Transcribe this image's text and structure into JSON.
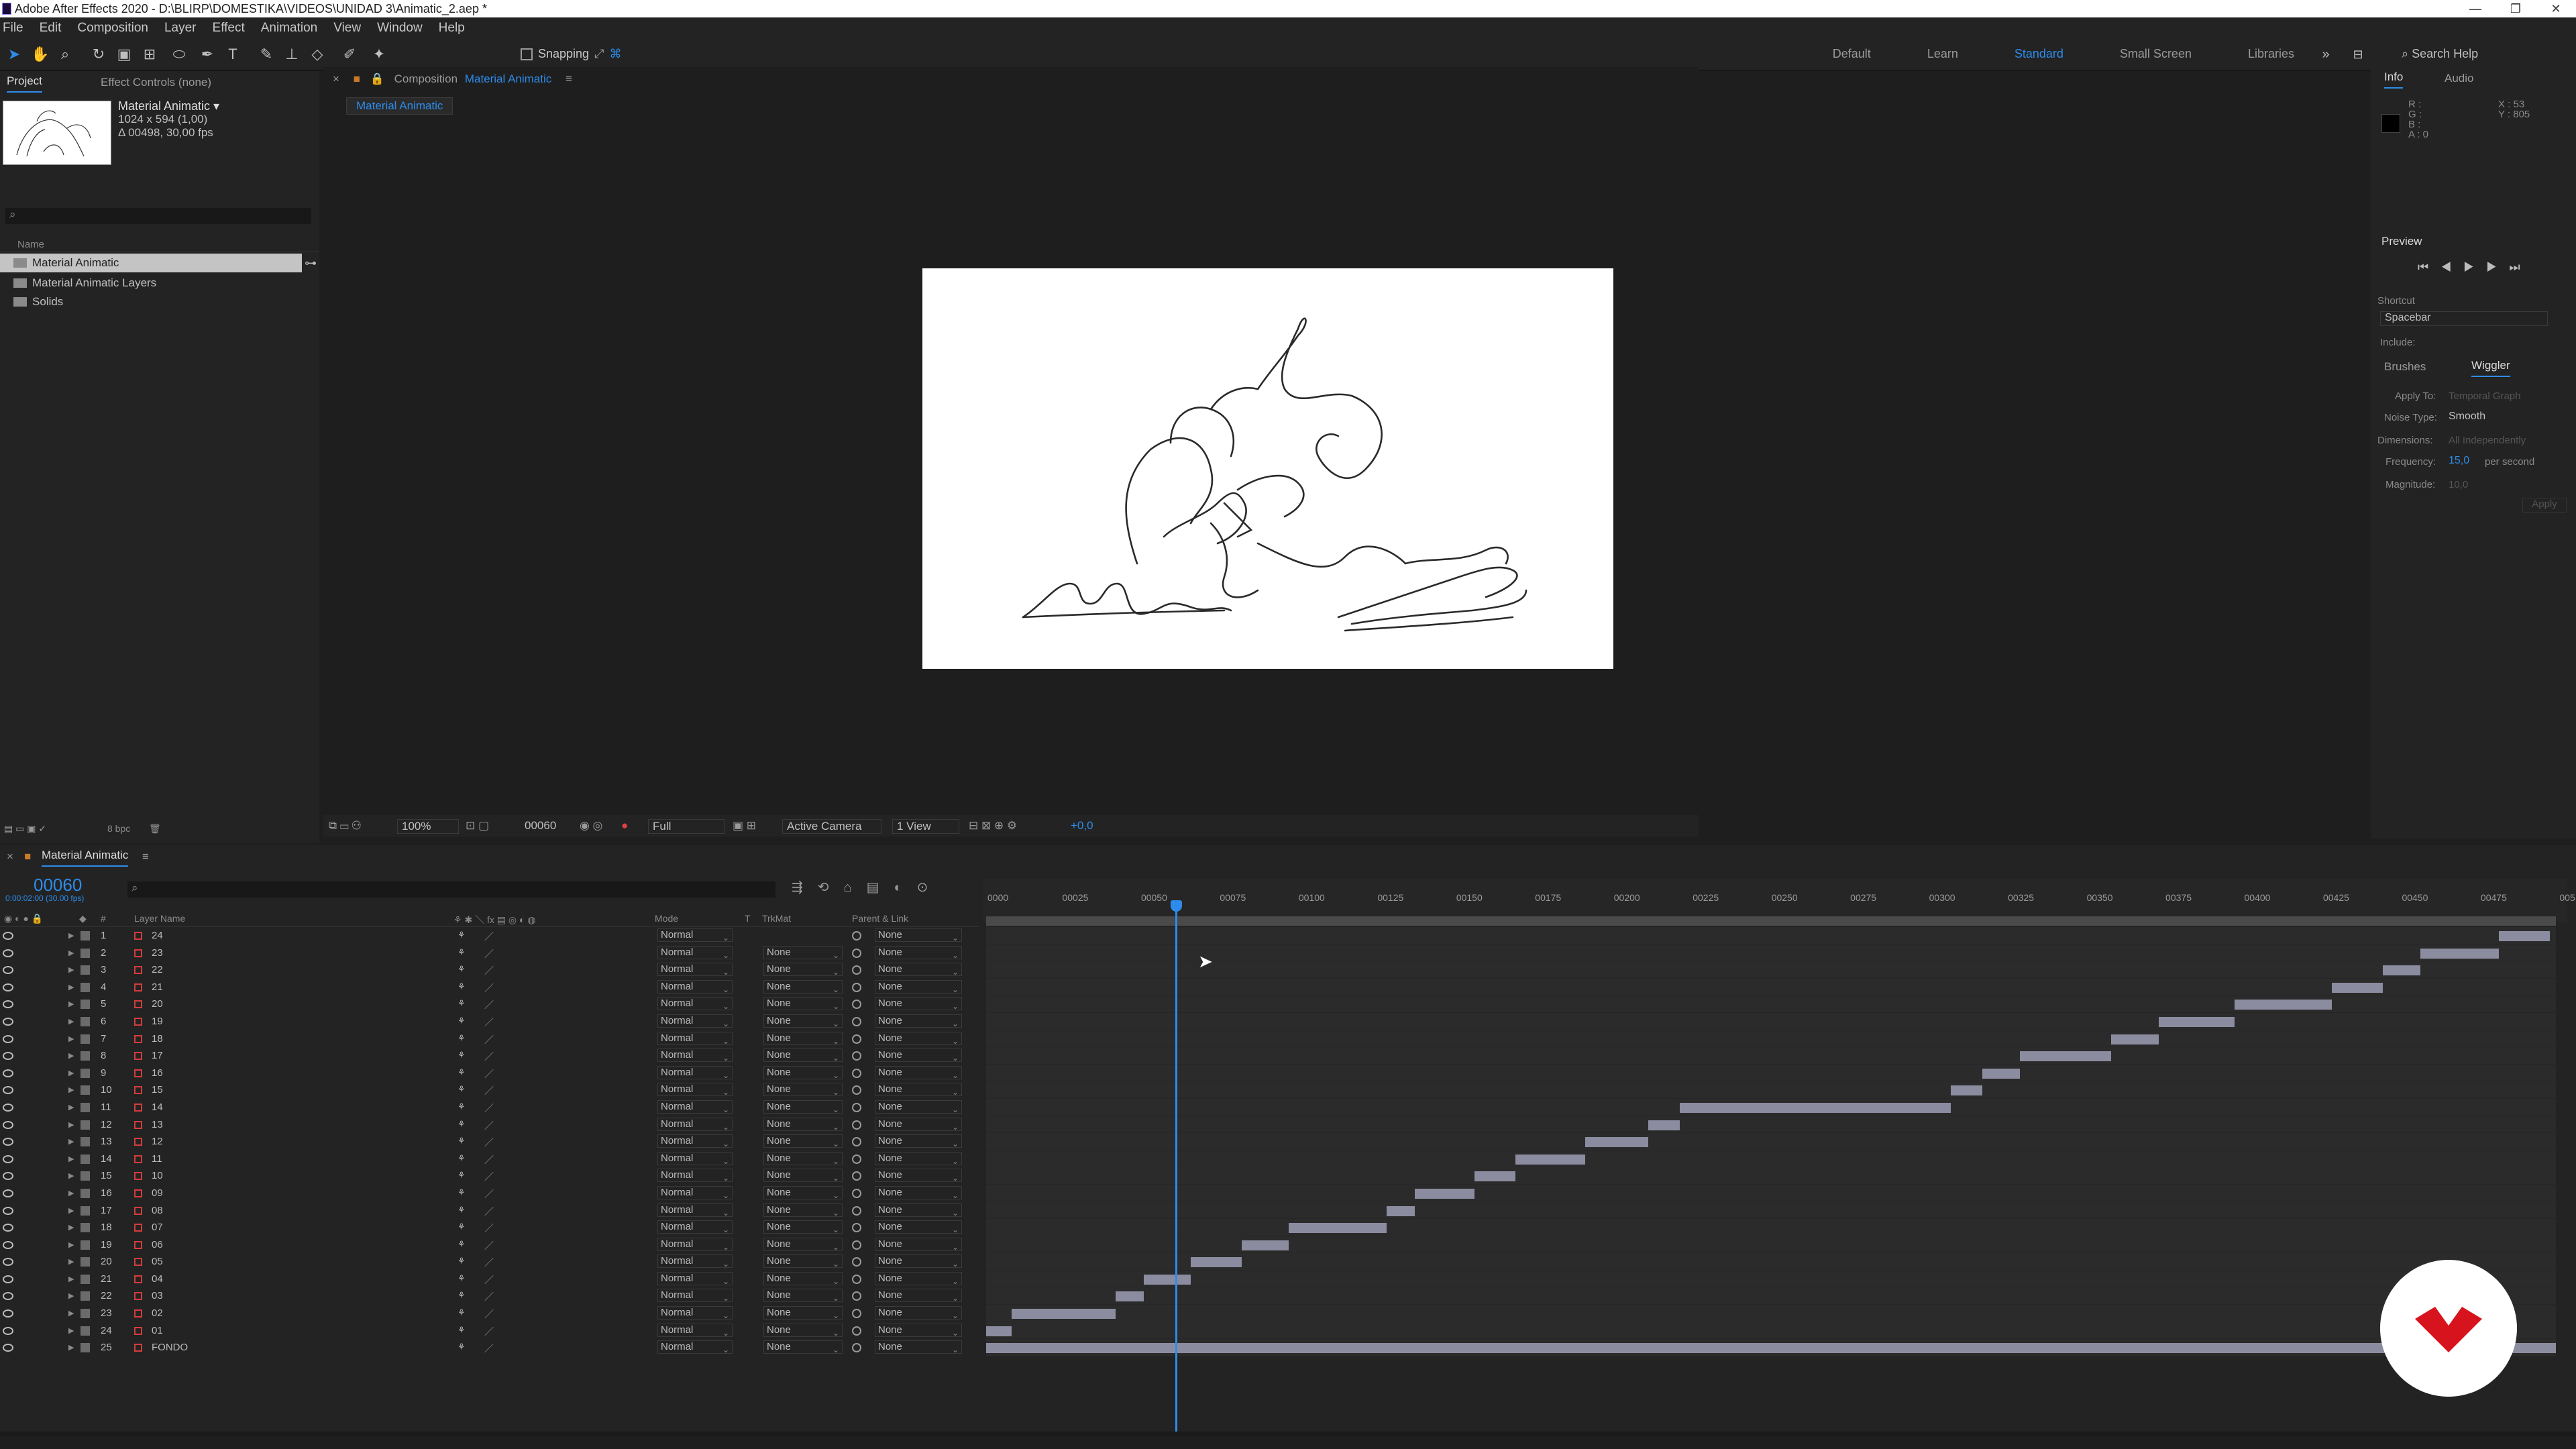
{
  "window": {
    "title": "Adobe After Effects 2020 - D:\\BLIRP\\DOMESTIKA\\VIDEOS\\UNIDAD 3\\Animatic_2.aep *",
    "controls": [
      "—",
      "❐",
      "✕"
    ]
  },
  "menu": [
    "File",
    "Edit",
    "Composition",
    "Layer",
    "Effect",
    "Animation",
    "View",
    "Window",
    "Help"
  ],
  "toolbar": {
    "snapping_label": "Snapping",
    "workspaces": [
      "Default",
      "Learn",
      "Standard",
      "Small Screen",
      "Libraries"
    ],
    "active_workspace": "Standard",
    "search_help": "Search Help"
  },
  "project": {
    "tab_project": "Project",
    "tab_effect_controls": "Effect Controls (none)",
    "selected_name": "Material Animatic ▾",
    "selected_dims": "1024 x 594 (1,00)",
    "selected_duration": "Δ 00498, 30,00 fps",
    "column_name": "Name",
    "items": [
      "Material Animatic",
      "Material Animatic Layers",
      "Solids"
    ],
    "bpc": "8 bpc"
  },
  "composition": {
    "tab_label": "Composition",
    "comp_name": "Material Animatic",
    "subtab": "Material Animatic",
    "zoom": "100%",
    "timecode": "00060",
    "resolution": "Full",
    "camera": "Active Camera",
    "views": "1 View",
    "exposure": "+0,0"
  },
  "info": {
    "tab_info": "Info",
    "tab_audio": "Audio",
    "r": "R :",
    "g": "G :",
    "b": "B :",
    "a": "A : 0",
    "x": "X : 53",
    "y": "Y : 805",
    "preview_title": "Preview",
    "shortcut_label": "Shortcut",
    "shortcut_value": "Spacebar",
    "include_label": "Include:",
    "tab_brushes": "Brushes",
    "tab_wiggler": "Wiggler",
    "apply_to_label": "Apply To:",
    "apply_to_value": "Temporal Graph",
    "noise_type_label": "Noise Type:",
    "noise_type_value": "Smooth",
    "dimensions_label": "Dimensions:",
    "dimensions_value": "All Independently",
    "frequency_label": "Frequency:",
    "frequency_value": "15,0",
    "frequency_unit": "per second",
    "magnitude_label": "Magnitude:",
    "magnitude_value": "10,0",
    "apply_button": "Apply"
  },
  "timeline": {
    "tab": "Material Animatic",
    "timecode": "00060",
    "timecode_sub": "0:00:02:00 (30.00 fps)",
    "columns": {
      "layer_name": "Layer Name",
      "mode": "Mode",
      "t": "T",
      "trkmat": "TrkMat",
      "parent": "Parent & Link"
    },
    "ruler_ticks": [
      "0000",
      "00025",
      "00050",
      "00075",
      "00100",
      "00125",
      "00150",
      "00175",
      "00200",
      "00225",
      "00250",
      "00275",
      "00300",
      "00325",
      "00350",
      "00375",
      "00400",
      "00425",
      "00450",
      "00475",
      "005"
    ],
    "current_frame": 60,
    "total_frames": 498,
    "layers": [
      {
        "num": "1",
        "name": "24",
        "mode": "Normal",
        "trkmat": "",
        "parent": "None",
        "in": 480,
        "out": 496
      },
      {
        "num": "2",
        "name": "23",
        "mode": "Normal",
        "trkmat": "None",
        "parent": "None",
        "in": 455,
        "out": 480
      },
      {
        "num": "3",
        "name": "22",
        "mode": "Normal",
        "trkmat": "None",
        "parent": "None",
        "in": 443,
        "out": 455
      },
      {
        "num": "4",
        "name": "21",
        "mode": "Normal",
        "trkmat": "None",
        "parent": "None",
        "in": 427,
        "out": 443
      },
      {
        "num": "5",
        "name": "20",
        "mode": "Normal",
        "trkmat": "None",
        "parent": "None",
        "in": 396,
        "out": 427
      },
      {
        "num": "6",
        "name": "19",
        "mode": "Normal",
        "trkmat": "None",
        "parent": "None",
        "in": 372,
        "out": 396
      },
      {
        "num": "7",
        "name": "18",
        "mode": "Normal",
        "trkmat": "None",
        "parent": "None",
        "in": 357,
        "out": 372
      },
      {
        "num": "8",
        "name": "17",
        "mode": "Normal",
        "trkmat": "None",
        "parent": "None",
        "in": 328,
        "out": 357
      },
      {
        "num": "9",
        "name": "16",
        "mode": "Normal",
        "trkmat": "None",
        "parent": "None",
        "in": 316,
        "out": 328
      },
      {
        "num": "10",
        "name": "15",
        "mode": "Normal",
        "trkmat": "None",
        "parent": "None",
        "in": 306,
        "out": 316
      },
      {
        "num": "11",
        "name": "14",
        "mode": "Normal",
        "trkmat": "None",
        "parent": "None",
        "in": 220,
        "out": 306
      },
      {
        "num": "12",
        "name": "13",
        "mode": "Normal",
        "trkmat": "None",
        "parent": "None",
        "in": 210,
        "out": 220
      },
      {
        "num": "13",
        "name": "12",
        "mode": "Normal",
        "trkmat": "None",
        "parent": "None",
        "in": 190,
        "out": 210
      },
      {
        "num": "14",
        "name": "11",
        "mode": "Normal",
        "trkmat": "None",
        "parent": "None",
        "in": 168,
        "out": 190
      },
      {
        "num": "15",
        "name": "10",
        "mode": "Normal",
        "trkmat": "None",
        "parent": "None",
        "in": 155,
        "out": 168
      },
      {
        "num": "16",
        "name": "09",
        "mode": "Normal",
        "trkmat": "None",
        "parent": "None",
        "in": 136,
        "out": 155
      },
      {
        "num": "17",
        "name": "08",
        "mode": "Normal",
        "trkmat": "None",
        "parent": "None",
        "in": 127,
        "out": 136
      },
      {
        "num": "18",
        "name": "07",
        "mode": "Normal",
        "trkmat": "None",
        "parent": "None",
        "in": 96,
        "out": 127
      },
      {
        "num": "19",
        "name": "06",
        "mode": "Normal",
        "trkmat": "None",
        "parent": "None",
        "in": 81,
        "out": 96
      },
      {
        "num": "20",
        "name": "05",
        "mode": "Normal",
        "trkmat": "None",
        "parent": "None",
        "in": 65,
        "out": 81
      },
      {
        "num": "21",
        "name": "04",
        "mode": "Normal",
        "trkmat": "None",
        "parent": "None",
        "in": 50,
        "out": 65
      },
      {
        "num": "22",
        "name": "03",
        "mode": "Normal",
        "trkmat": "None",
        "parent": "None",
        "in": 41,
        "out": 50
      },
      {
        "num": "23",
        "name": "02",
        "mode": "Normal",
        "trkmat": "None",
        "parent": "None",
        "in": 8,
        "out": 41
      },
      {
        "num": "24",
        "name": "01",
        "mode": "Normal",
        "trkmat": "None",
        "parent": "None",
        "in": 0,
        "out": 8
      },
      {
        "num": "25",
        "name": "FONDO",
        "mode": "Normal",
        "trkmat": "None",
        "parent": "None",
        "in": 0,
        "out": 498
      }
    ]
  },
  "colors": {
    "accent": "#2d8ceb",
    "layer_bar": "#8c8ca0",
    "badge_red": "#d7141e"
  }
}
